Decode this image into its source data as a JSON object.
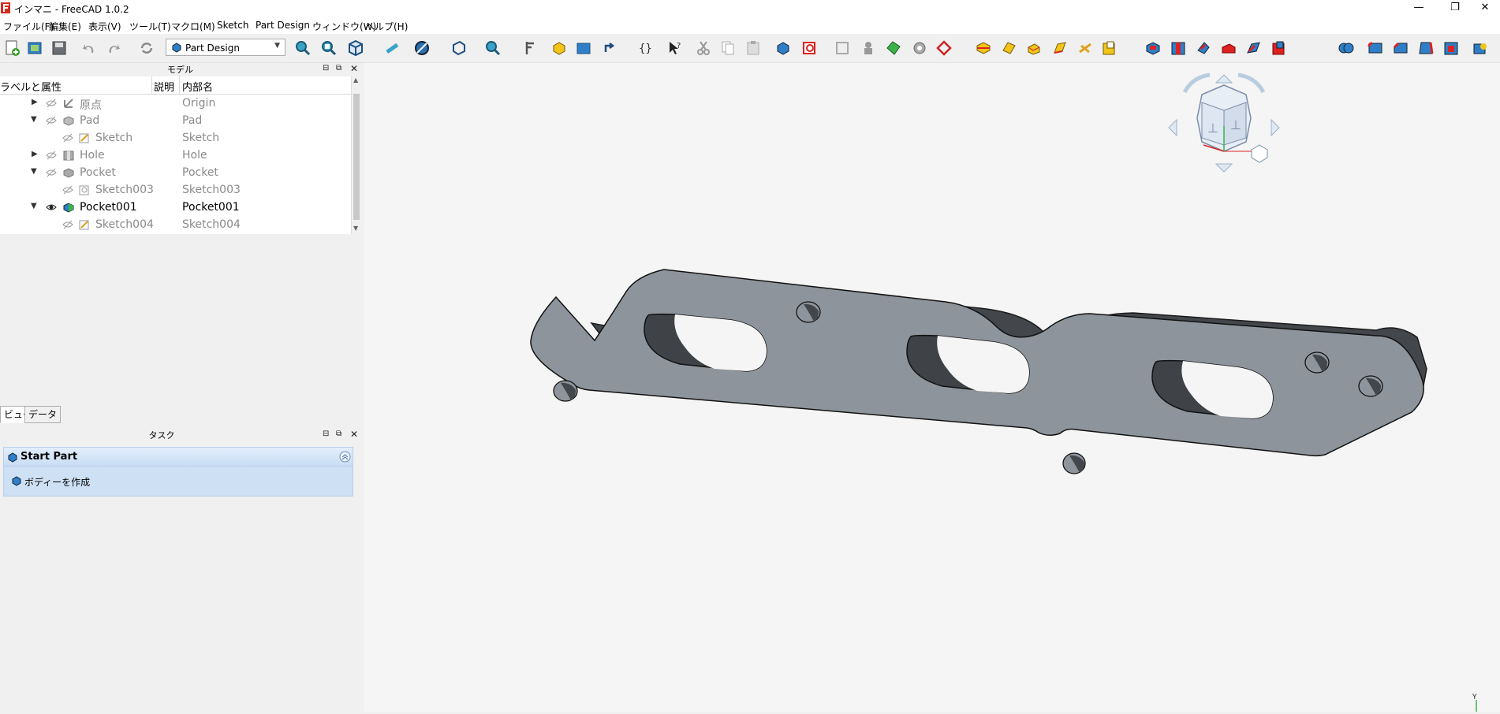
{
  "window": {
    "title": "インマニ - FreeCAD 1.0.2",
    "minimize_glyph": "—",
    "restore_glyph": "❐",
    "close_glyph": "✕"
  },
  "menu": [
    "ファイル(F)",
    "編集(E)",
    "表示(V)",
    "ツール(T)",
    "マクロ(M)",
    "Sketch",
    "Part Design",
    "ウィンドウ(W)",
    "ヘルプ(H)"
  ],
  "toolbar": {
    "workbench": "Part Design",
    "icons": [
      "new-file-icon",
      "open-file-icon",
      "save-icon",
      "undo-icon",
      "redo-icon",
      "refresh-icon",
      "fit-all-icon",
      "fit-selection-icon",
      "view-iso-icon",
      "measure-icon",
      "draw-style-icon",
      "bounding-box-icon",
      "zoom-icon",
      "caliper-icon",
      "part-icon",
      "group-icon",
      "link-icon",
      "expression-icon",
      "whats-this-icon",
      "cut-icon",
      "copy-icon",
      "paste-icon",
      "body-icon",
      "sketch-icon",
      "validate-sketch-icon",
      "clone-icon",
      "shape-binder-icon",
      "sub-shape-binder-icon",
      "datum-icon",
      "pad-icon",
      "revolution-icon",
      "loft-icon",
      "pipe-icon",
      "helix-icon",
      "additive-primitive-icon",
      "pocket-icon",
      "hole-icon",
      "groove-icon",
      "subtractive-loft-icon",
      "subtractive-pipe-icon",
      "subtractive-primitive-icon",
      "boolean-icon",
      "fillet-icon",
      "chamfer-icon",
      "draft-icon",
      "thickness-icon"
    ]
  },
  "model_panel": {
    "title": "モデル",
    "columns": [
      "ラベルと属性",
      "説明",
      "内部名"
    ],
    "rows": [
      {
        "label": "原点",
        "internal": "Origin",
        "icon": "origin-icon"
      },
      {
        "label": "Pad",
        "internal": "Pad",
        "icon": "pad-feature-icon"
      },
      {
        "label": "Sketch",
        "internal": "Sketch",
        "icon": "sketch-feature-icon"
      },
      {
        "label": "Hole",
        "internal": "Hole",
        "icon": "hole-feature-icon"
      },
      {
        "label": "Pocket",
        "internal": "Pocket",
        "icon": "pocket-feature-icon"
      },
      {
        "label": "Sketch003",
        "internal": "Sketch003",
        "icon": "sketch-feature-icon"
      },
      {
        "label": "Pocket001",
        "internal": "Pocket001",
        "icon": "pocket-active-icon"
      },
      {
        "label": "Sketch004",
        "internal": "Sketch004",
        "icon": "sketch-feature-icon"
      }
    ],
    "tabs": [
      "ビュー",
      "データ"
    ]
  },
  "task_panel": {
    "title": "タスク",
    "header": "Start Part",
    "action": "ボディーを作成"
  },
  "viewport": {
    "background": "#f5f5f5",
    "part_color": "#8e949b",
    "part_side_color": "#43474b",
    "axis_label": "Y"
  }
}
